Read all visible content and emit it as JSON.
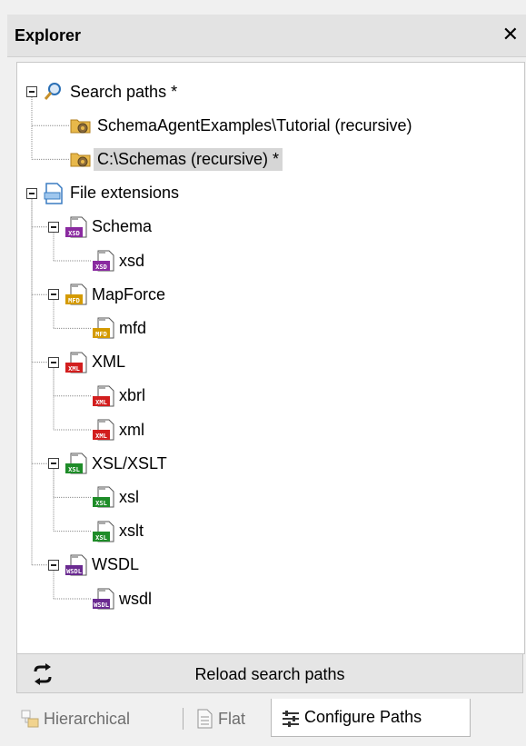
{
  "panel": {
    "title": "Explorer",
    "close_glyph": "✕"
  },
  "tree": [
    {
      "name": "search-paths",
      "label": "Search paths *",
      "icon": "search-icon",
      "expanded": true,
      "children": [
        {
          "name": "schema-agent-examples-path",
          "label": "SchemaAgentExamples\\Tutorial (recursive)",
          "icon": "folder-gear-icon"
        },
        {
          "name": "c-schemas-path",
          "label": "C:\\Schemas (recursive) *",
          "icon": "folder-gear-icon",
          "selected": true
        }
      ]
    },
    {
      "name": "file-extensions",
      "label": "File extensions",
      "icon": "file-extensions-icon",
      "expanded": true,
      "children": [
        {
          "name": "schema",
          "label": "Schema",
          "icon": "xsd-file-icon",
          "badge": "XSD",
          "color": "#8a2aa0",
          "expanded": true,
          "children": [
            {
              "name": "xsd",
              "label": "xsd",
              "icon": "xsd-file-icon",
              "badge": "XSD",
              "color": "#8a2aa0"
            }
          ]
        },
        {
          "name": "mapforce",
          "label": "MapForce",
          "icon": "mfd-file-icon",
          "badge": "MFD",
          "color": "#d49a00",
          "expanded": true,
          "children": [
            {
              "name": "mfd",
              "label": "mfd",
              "icon": "mfd-file-icon",
              "badge": "MFD",
              "color": "#d49a00"
            }
          ]
        },
        {
          "name": "xml",
          "label": "XML",
          "icon": "xml-file-icon",
          "badge": "XML",
          "color": "#d21e1e",
          "expanded": true,
          "children": [
            {
              "name": "xbrl",
              "label": "xbrl",
              "icon": "xml-file-icon",
              "badge": "XML",
              "color": "#d21e1e"
            },
            {
              "name": "xml-ext",
              "label": "xml",
              "icon": "xml-file-icon",
              "badge": "XML",
              "color": "#d21e1e"
            }
          ]
        },
        {
          "name": "xsl-xslt",
          "label": "XSL/XSLT",
          "icon": "xsl-file-icon",
          "badge": "XSL",
          "color": "#1e8c28",
          "expanded": true,
          "children": [
            {
              "name": "xsl",
              "label": "xsl",
              "icon": "xsl-file-icon",
              "badge": "XSL",
              "color": "#1e8c28"
            },
            {
              "name": "xslt",
              "label": "xslt",
              "icon": "xsl-file-icon",
              "badge": "XSL",
              "color": "#1e8c28"
            }
          ]
        },
        {
          "name": "wsdl",
          "label": "WSDL",
          "icon": "wsdl-file-icon",
          "badge": "WSDL",
          "color": "#6a2a90",
          "expanded": true,
          "children": [
            {
              "name": "wsdl-ext",
              "label": "wsdl",
              "icon": "wsdl-file-icon",
              "badge": "WSDL",
              "color": "#6a2a90"
            }
          ]
        }
      ]
    }
  ],
  "reload": {
    "label": "Reload search paths",
    "icon": "reload-icon"
  },
  "tabs": [
    {
      "name": "tab-hierarchical",
      "label": "Hierarchical",
      "icon": "hierarchical-icon",
      "active": false
    },
    {
      "name": "tab-flat",
      "label": "Flat",
      "icon": "flat-document-icon",
      "active": false
    },
    {
      "name": "tab-configure-paths",
      "label": "Configure Paths",
      "icon": "configure-paths-icon",
      "active": true
    }
  ]
}
